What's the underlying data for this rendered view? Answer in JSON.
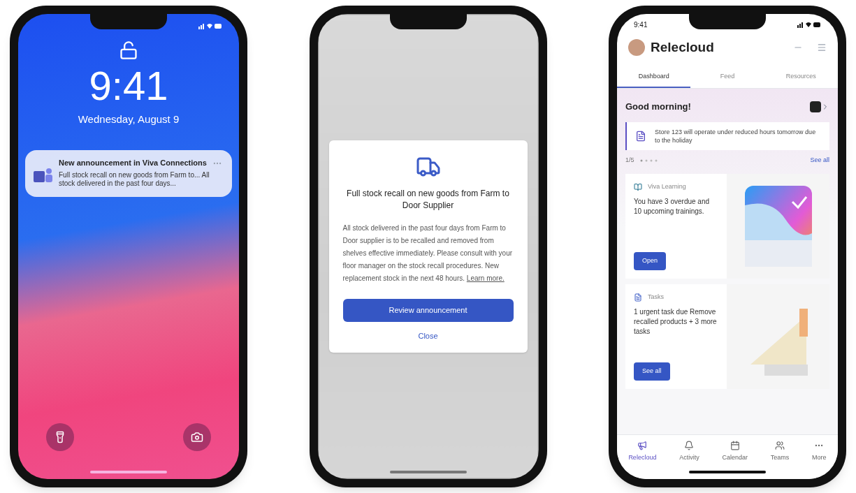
{
  "lock_screen": {
    "time": "9:41",
    "date": "Wednesday, August 9",
    "notification": {
      "title": "New announcement in Viva Connections",
      "body": "Full stock recall on new goods from Farm to... All stock delivered in the past four days..."
    }
  },
  "announcement_dialog": {
    "title": "Full stock recall on new goods from Farm to Door Supplier",
    "body": "All stock delivered in the past four days from Farm to Door supplier is to be recalled and removed from shelves effective immediately. Please consult with your floor manager on the stock recall procedures. New replacement stock in the next 48 hours.",
    "link": "Learn more.",
    "primary_button": "Review announcement",
    "secondary_button": "Close"
  },
  "dashboard": {
    "status_time": "9:41",
    "app_title": "Relecloud",
    "tabs": [
      {
        "label": "Dashboard",
        "selected": true
      },
      {
        "label": "Feed",
        "selected": false
      },
      {
        "label": "Resources",
        "selected": false
      }
    ],
    "greeting": "Good morning!",
    "announcement": "Store 123 will operate under reduced hours tomorrow due to the holiday",
    "pager": "1/5",
    "see_all": "See all",
    "cards": [
      {
        "kind": "learning",
        "source": "Viva Learning",
        "text": "You have 3 overdue and 10 upcoming trainings.",
        "button": "Open"
      },
      {
        "kind": "tasks",
        "source": "Tasks",
        "text": "1 urgent task due Remove recalled products + 3 more tasks",
        "button": "See all"
      }
    ],
    "nav": [
      {
        "kind": "home",
        "label": "Relecloud",
        "selected": true
      },
      {
        "kind": "activity",
        "label": "Activity",
        "selected": false
      },
      {
        "kind": "calendar",
        "label": "Calendar",
        "selected": false
      },
      {
        "kind": "teams",
        "label": "Teams",
        "selected": false
      },
      {
        "kind": "more",
        "label": "More",
        "selected": false
      }
    ]
  }
}
